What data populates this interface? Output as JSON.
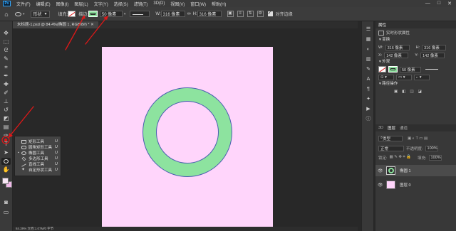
{
  "app": {
    "logo_text": "Ps"
  },
  "menubar": {
    "items": [
      "文件(F)",
      "编辑(E)",
      "图像(I)",
      "图层(L)",
      "文字(Y)",
      "选择(S)",
      "滤镜(T)",
      "3D(D)",
      "视图(V)",
      "窗口(W)",
      "帮助(H)"
    ],
    "window_buttons": [
      "—",
      "□",
      "✕"
    ]
  },
  "options_bar": {
    "tool_mode": "形状",
    "fill_label": "填充:",
    "stroke_label": "描边:",
    "stroke_width": "50 像素",
    "w_label": "W:",
    "w_value": "316 像素",
    "link_glyph": "∞",
    "h_label": "H:",
    "h_value": "316 像素",
    "align_label": "对齐边缘",
    "stroke_color": "#8de39f"
  },
  "document_tab": {
    "title": "未标题-1.psd @ 84.4%(椭圆 1, RGB/8#) * ✕"
  },
  "flyout": {
    "items": [
      {
        "label": "矩形工具",
        "shortcut": "U",
        "icon": "rect"
      },
      {
        "label": "圆角矩形工具",
        "shortcut": "U",
        "icon": "round"
      },
      {
        "label": "椭圆工具",
        "shortcut": "U",
        "icon": "ell"
      },
      {
        "label": "多边形工具",
        "shortcut": "U",
        "icon": "poly"
      },
      {
        "label": "直线工具",
        "shortcut": "U",
        "icon": "line"
      },
      {
        "label": "自定形状工具",
        "shortcut": "U",
        "icon": "custom"
      }
    ],
    "active_marker": "▪"
  },
  "canvas": {
    "document_color": "#ffd5fb",
    "ring_fill": "#8de39f",
    "ring_stroke": "#4a5fb0"
  },
  "statusbar": {
    "text": "84.39%    文档:1.07M/0 字节"
  },
  "properties": {
    "tab_title": "属性",
    "subtitle": "实时形状属性",
    "transform_section": "变换",
    "w_label": "W:",
    "w_value": "316 像素",
    "h_label": "H:",
    "h_value": "316 像素",
    "x_label": "X:",
    "x_value": "142 像素",
    "y_label": "Y:",
    "y_value": "142 像素",
    "appearance_section": "外观",
    "stroke_width": "50 像素",
    "path_ops_section": "路径操作"
  },
  "layers": {
    "tabs": [
      "3D",
      "图层",
      "通道"
    ],
    "filter_label": "类型",
    "blend_mode": "正常",
    "opacity_label": "不透明度:",
    "opacity_value": "100%",
    "lock_label": "锁定:",
    "fill_label": "填充:",
    "fill_value": "100%",
    "items": [
      {
        "name": "椭圆 1",
        "selected": true
      },
      {
        "name": "图层 0",
        "selected": false
      }
    ]
  }
}
